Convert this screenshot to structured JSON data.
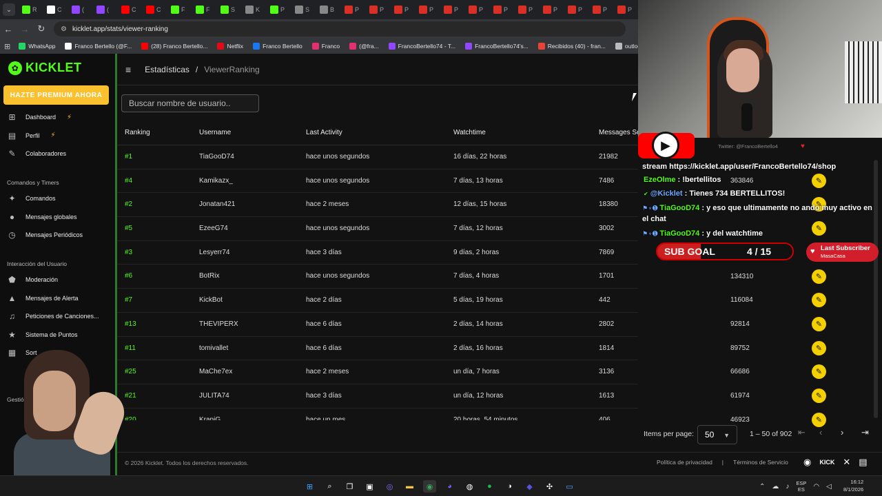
{
  "browser": {
    "url": "kicklet.app/stats/viewer-ranking",
    "tabs": [
      {
        "letter": "R",
        "color": "#53fc18"
      },
      {
        "letter": "C",
        "color": "#ffffff"
      },
      {
        "letter": "(",
        "color": "#9146ff"
      },
      {
        "letter": "(",
        "color": "#9146ff"
      },
      {
        "letter": "C",
        "color": "#ff0000"
      },
      {
        "letter": "C",
        "color": "#ff0000"
      },
      {
        "letter": "F",
        "color": "#53fc18"
      },
      {
        "letter": "F",
        "color": "#53fc18"
      },
      {
        "letter": "S",
        "color": "#53fc18"
      },
      {
        "letter": "K",
        "color": "#888888"
      },
      {
        "letter": "P",
        "color": "#53fc18"
      },
      {
        "letter": "S",
        "color": "#888888"
      },
      {
        "letter": "B",
        "color": "#888888"
      },
      {
        "letter": "P",
        "color": "#d93025"
      },
      {
        "letter": "P",
        "color": "#d93025"
      },
      {
        "letter": "P",
        "color": "#d93025"
      },
      {
        "letter": "P",
        "color": "#d93025"
      },
      {
        "letter": "P",
        "color": "#d93025"
      },
      {
        "letter": "P",
        "color": "#d93025"
      },
      {
        "letter": "P",
        "color": "#d93025"
      },
      {
        "letter": "P",
        "color": "#d93025"
      },
      {
        "letter": "P",
        "color": "#d93025"
      },
      {
        "letter": "P",
        "color": "#d93025"
      },
      {
        "letter": "P",
        "color": "#d93025"
      },
      {
        "letter": "P",
        "color": "#d93025"
      }
    ],
    "bookmarks": [
      {
        "label": "WhatsApp",
        "color": "#25d366"
      },
      {
        "label": "Franco Bertello (@F...",
        "color": "#ffffff"
      },
      {
        "label": "(28) Franco Bertello...",
        "color": "#ff0000"
      },
      {
        "label": "Netflix",
        "color": "#e50914"
      },
      {
        "label": "Franco Bertello",
        "color": "#1877f2"
      },
      {
        "label": "Franco",
        "color": "#e1306c"
      },
      {
        "label": "(@fra...",
        "color": "#e1306c"
      },
      {
        "label": "FrancoBertello74 - T...",
        "color": "#9146ff"
      },
      {
        "label": "FrancoBertello74's...",
        "color": "#9146ff"
      },
      {
        "label": "Recibidos (40) - fran...",
        "color": "#ea4335"
      },
      {
        "label": "outlook",
        "color": "#bbbbbb"
      },
      {
        "label": "Aler",
        "color": "#53fc18"
      }
    ]
  },
  "sidebar": {
    "logo": "KICKLET",
    "premium": "HAZTE PREMIUM AHORA",
    "items": [
      {
        "label": "Dashboard",
        "icon": "⊞",
        "badge": true
      },
      {
        "label": "Perfil",
        "icon": "▤",
        "badge": true
      },
      {
        "label": "Colaboradores",
        "icon": "✎",
        "badge": false
      }
    ],
    "section1": "Comandos y Timers",
    "items2": [
      {
        "label": "Comandos",
        "icon": "✦"
      },
      {
        "label": "Mensajes globales",
        "icon": "●"
      },
      {
        "label": "Mensajes Periódicos",
        "icon": "◷"
      }
    ],
    "section2": "Interacción del Usuario",
    "items3": [
      {
        "label": "Moderación",
        "icon": "⬟"
      },
      {
        "label": "Mensajes de Alerta",
        "icon": "▲"
      },
      {
        "label": "Peticiones de Canciones...",
        "icon": "♫"
      },
      {
        "label": "Sistema de Puntos",
        "icon": "★"
      },
      {
        "label": "Sort",
        "icon": "▦"
      }
    ],
    "section3": "Gestión"
  },
  "header": {
    "crumb1": "Estadísticas",
    "sep": "/",
    "crumb2": "ViewerRanking"
  },
  "search": {
    "placeholder": "Buscar nombre de usuario.."
  },
  "table": {
    "headers": [
      "Ranking",
      "Username",
      "Last Activity",
      "Watchtime",
      "Messages Se"
    ],
    "rows": [
      [
        "#1",
        "TiaGooD74",
        "hace unos segundos",
        "16 días, 22 horas",
        "21982"
      ],
      [
        "#4",
        "Kamikazx_",
        "hace unos segundos",
        "7 días, 13 horas",
        "7486"
      ],
      [
        "#2",
        "Jonatan421",
        "hace 2 meses",
        "12 días, 15 horas",
        "18380"
      ],
      [
        "#5",
        "EzeeG74",
        "hace unos segundos",
        "7 días, 12 horas",
        "3002"
      ],
      [
        "#3",
        "Lesyerr74",
        "hace 3 días",
        "9 días, 2 horas",
        "7869"
      ],
      [
        "#6",
        "BotRix",
        "hace unos segundos",
        "7 días, 4 horas",
        "1701"
      ],
      [
        "#7",
        "KickBot",
        "hace 2 días",
        "5 días, 19 horas",
        "442"
      ],
      [
        "#13",
        "THEVIPERX",
        "hace 6 días",
        "2 días, 14 horas",
        "2802"
      ],
      [
        "#11",
        "tomivallet",
        "hace 6 días",
        "2 días, 16 horas",
        "1814"
      ],
      [
        "#25",
        "MaChe7ex",
        "hace 2 meses",
        "un día, 7 horas",
        "3136"
      ],
      [
        "#21",
        "JULITA74",
        "hace 3 días",
        "un día, 12 horas",
        "1613"
      ],
      [
        "#20",
        "KrapiG",
        "hace un mes",
        "20 horas, 54 minutos",
        "406"
      ]
    ],
    "right_col": [
      "",
      "363846",
      "",
      "",
      "",
      "134310",
      "116084",
      "92814",
      "89752",
      "66686",
      "61974",
      "46923"
    ]
  },
  "pager": {
    "label": "Items per page:",
    "value": "50",
    "range": "1 – 50 of 902"
  },
  "footer": {
    "copy": "© 2026 Kicklet. Todos los derechos reservados.",
    "privacy": "Política de privacidad",
    "sep": "|",
    "terms": "Términos de Servicio"
  },
  "overlay": {
    "twitter": "Twitter: @FrancoBertello4",
    "chat": [
      {
        "user": "",
        "text": "stream https://kicklet.app/user/FrancoBertello74/shop"
      },
      {
        "user": "EzeOlme",
        "text": " : !bertellitos"
      },
      {
        "user": "@Kicklet",
        "text": " : Tienes 734 BERTELLITOS!"
      },
      {
        "user": "TiaGooD74",
        "text": " : y eso que ultimamente no ando muy activo en el chat"
      },
      {
        "user": "TiaGooD74",
        "text": " : y del watchtime"
      }
    ],
    "subgoal_label": "SUB GOAL",
    "subgoal_count": "4 / 15",
    "subgoal_current": 4,
    "subgoal_target": 15,
    "last_sub_title": "Last Subscriber",
    "last_sub_name": "MasaCasa"
  },
  "taskbar": {
    "lang1": "ESP",
    "lang2": "ES",
    "time": "16:12",
    "date": "8/1/2026"
  },
  "colors": {
    "accent": "#53fc18",
    "premium": "#fbc02d",
    "edit": "#f5d000",
    "live": "#ff0000"
  }
}
